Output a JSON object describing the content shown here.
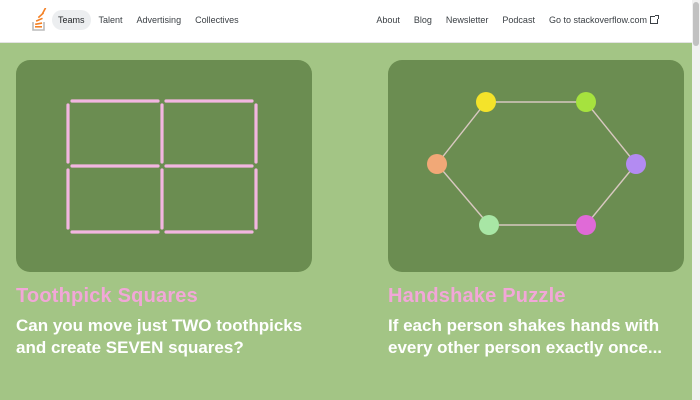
{
  "nav": {
    "left": [
      "Teams",
      "Talent",
      "Advertising",
      "Collectives"
    ],
    "right": [
      "About",
      "Blog",
      "Newsletter",
      "Podcast",
      "Go to stackoverflow.com"
    ],
    "active": "Teams"
  },
  "icons": {
    "logo": "stackoverflow-logo-icon",
    "external": "external-link-icon"
  },
  "colors": {
    "page_bg": "#a3c585",
    "card_bg": "#6b8d51",
    "title": "#f2a7d8",
    "body_text": "#ffffff",
    "toothpick": "#f2b6e0",
    "hexagon_line": "#d8c8c0",
    "node_colors": [
      "#f4e32a",
      "#a6e23e",
      "#b38bf2",
      "#e06ad7",
      "#a8e6a5",
      "#f1a877"
    ]
  },
  "cards": [
    {
      "title": "Toothpick Squares",
      "description": "Can you move just TWO toothpicks and create SEVEN squares?"
    },
    {
      "title": "Handshake Puzzle",
      "description": "If each person shakes hands with every other person exactly once..."
    }
  ]
}
